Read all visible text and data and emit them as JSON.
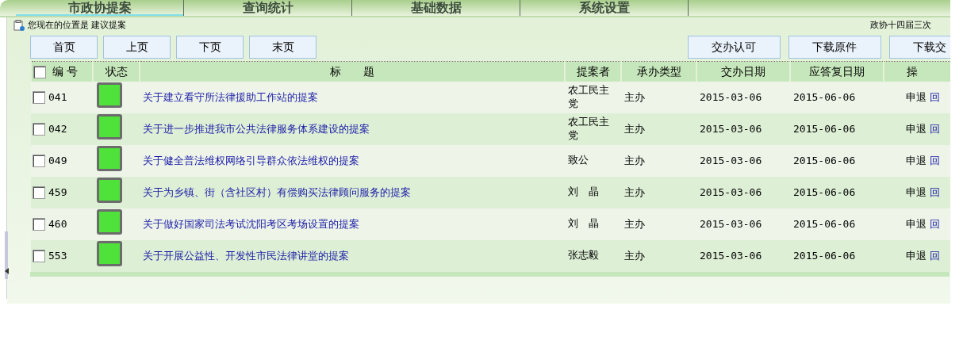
{
  "tabs": [
    {
      "label": "市政协提案",
      "selected": true
    },
    {
      "label": "查询统计",
      "selected": false
    },
    {
      "label": "基础数据",
      "selected": false
    },
    {
      "label": "系统设置",
      "selected": false
    }
  ],
  "breadcrumb": "您现在的位置是 建议提案",
  "session": "政协十四届三次",
  "pager_buttons": [
    "首页",
    "上页",
    "下页",
    "末页"
  ],
  "action_buttons": [
    "交办认可",
    "下载原件",
    "下载交"
  ],
  "table": {
    "select_all": {
      "checked": false
    },
    "columns": [
      "编 号",
      "状态",
      "标　　题",
      "提案者",
      "承办类型",
      "交办日期",
      "应答复日期",
      "操"
    ],
    "rows": [
      {
        "checked": false,
        "number": "041",
        "color": "#4fe23a",
        "title": "关于建立看守所法律援助工作站的提案",
        "proposer": "农工民主党",
        "type": "主办",
        "assigned": "2015-03-06",
        "due": "2015-06-06",
        "action": "申退",
        "link": "回"
      },
      {
        "checked": false,
        "number": "042",
        "color": "#4fe23a",
        "title": "关于进一步推进我市公共法律服务体系建设的提案",
        "proposer": "农工民主党",
        "type": "主办",
        "assigned": "2015-03-06",
        "due": "2015-06-06",
        "action": "申退",
        "link": "回"
      },
      {
        "checked": false,
        "number": "049",
        "color": "#4fe23a",
        "title": "关于健全普法维权网络引导群众依法维权的提案",
        "proposer": "致公",
        "type": "主办",
        "assigned": "2015-03-06",
        "due": "2015-06-06",
        "action": "申退",
        "link": "回"
      },
      {
        "checked": false,
        "number": "459",
        "color": "#4fe23a",
        "title": "关于为乡镇、街（含社区村）有偿购买法律顾问服务的提案",
        "proposer": "刘　晶",
        "type": "主办",
        "assigned": "2015-03-06",
        "due": "2015-06-06",
        "action": "申退",
        "link": "回"
      },
      {
        "checked": false,
        "number": "460",
        "color": "#4fe23a",
        "title": "关于做好国家司法考试沈阳考区考场设置的提案",
        "proposer": "刘　晶",
        "type": "主办",
        "assigned": "2015-03-06",
        "due": "2015-06-06",
        "action": "申退",
        "link": "回"
      },
      {
        "checked": false,
        "number": "553",
        "color": "#4fe23a",
        "title": "关于开展公益性、开发性市民法律讲堂的提案",
        "proposer": "张志毅",
        "type": "主办",
        "assigned": "2015-03-06",
        "due": "2015-06-06",
        "action": "申退",
        "link": "回"
      }
    ]
  }
}
